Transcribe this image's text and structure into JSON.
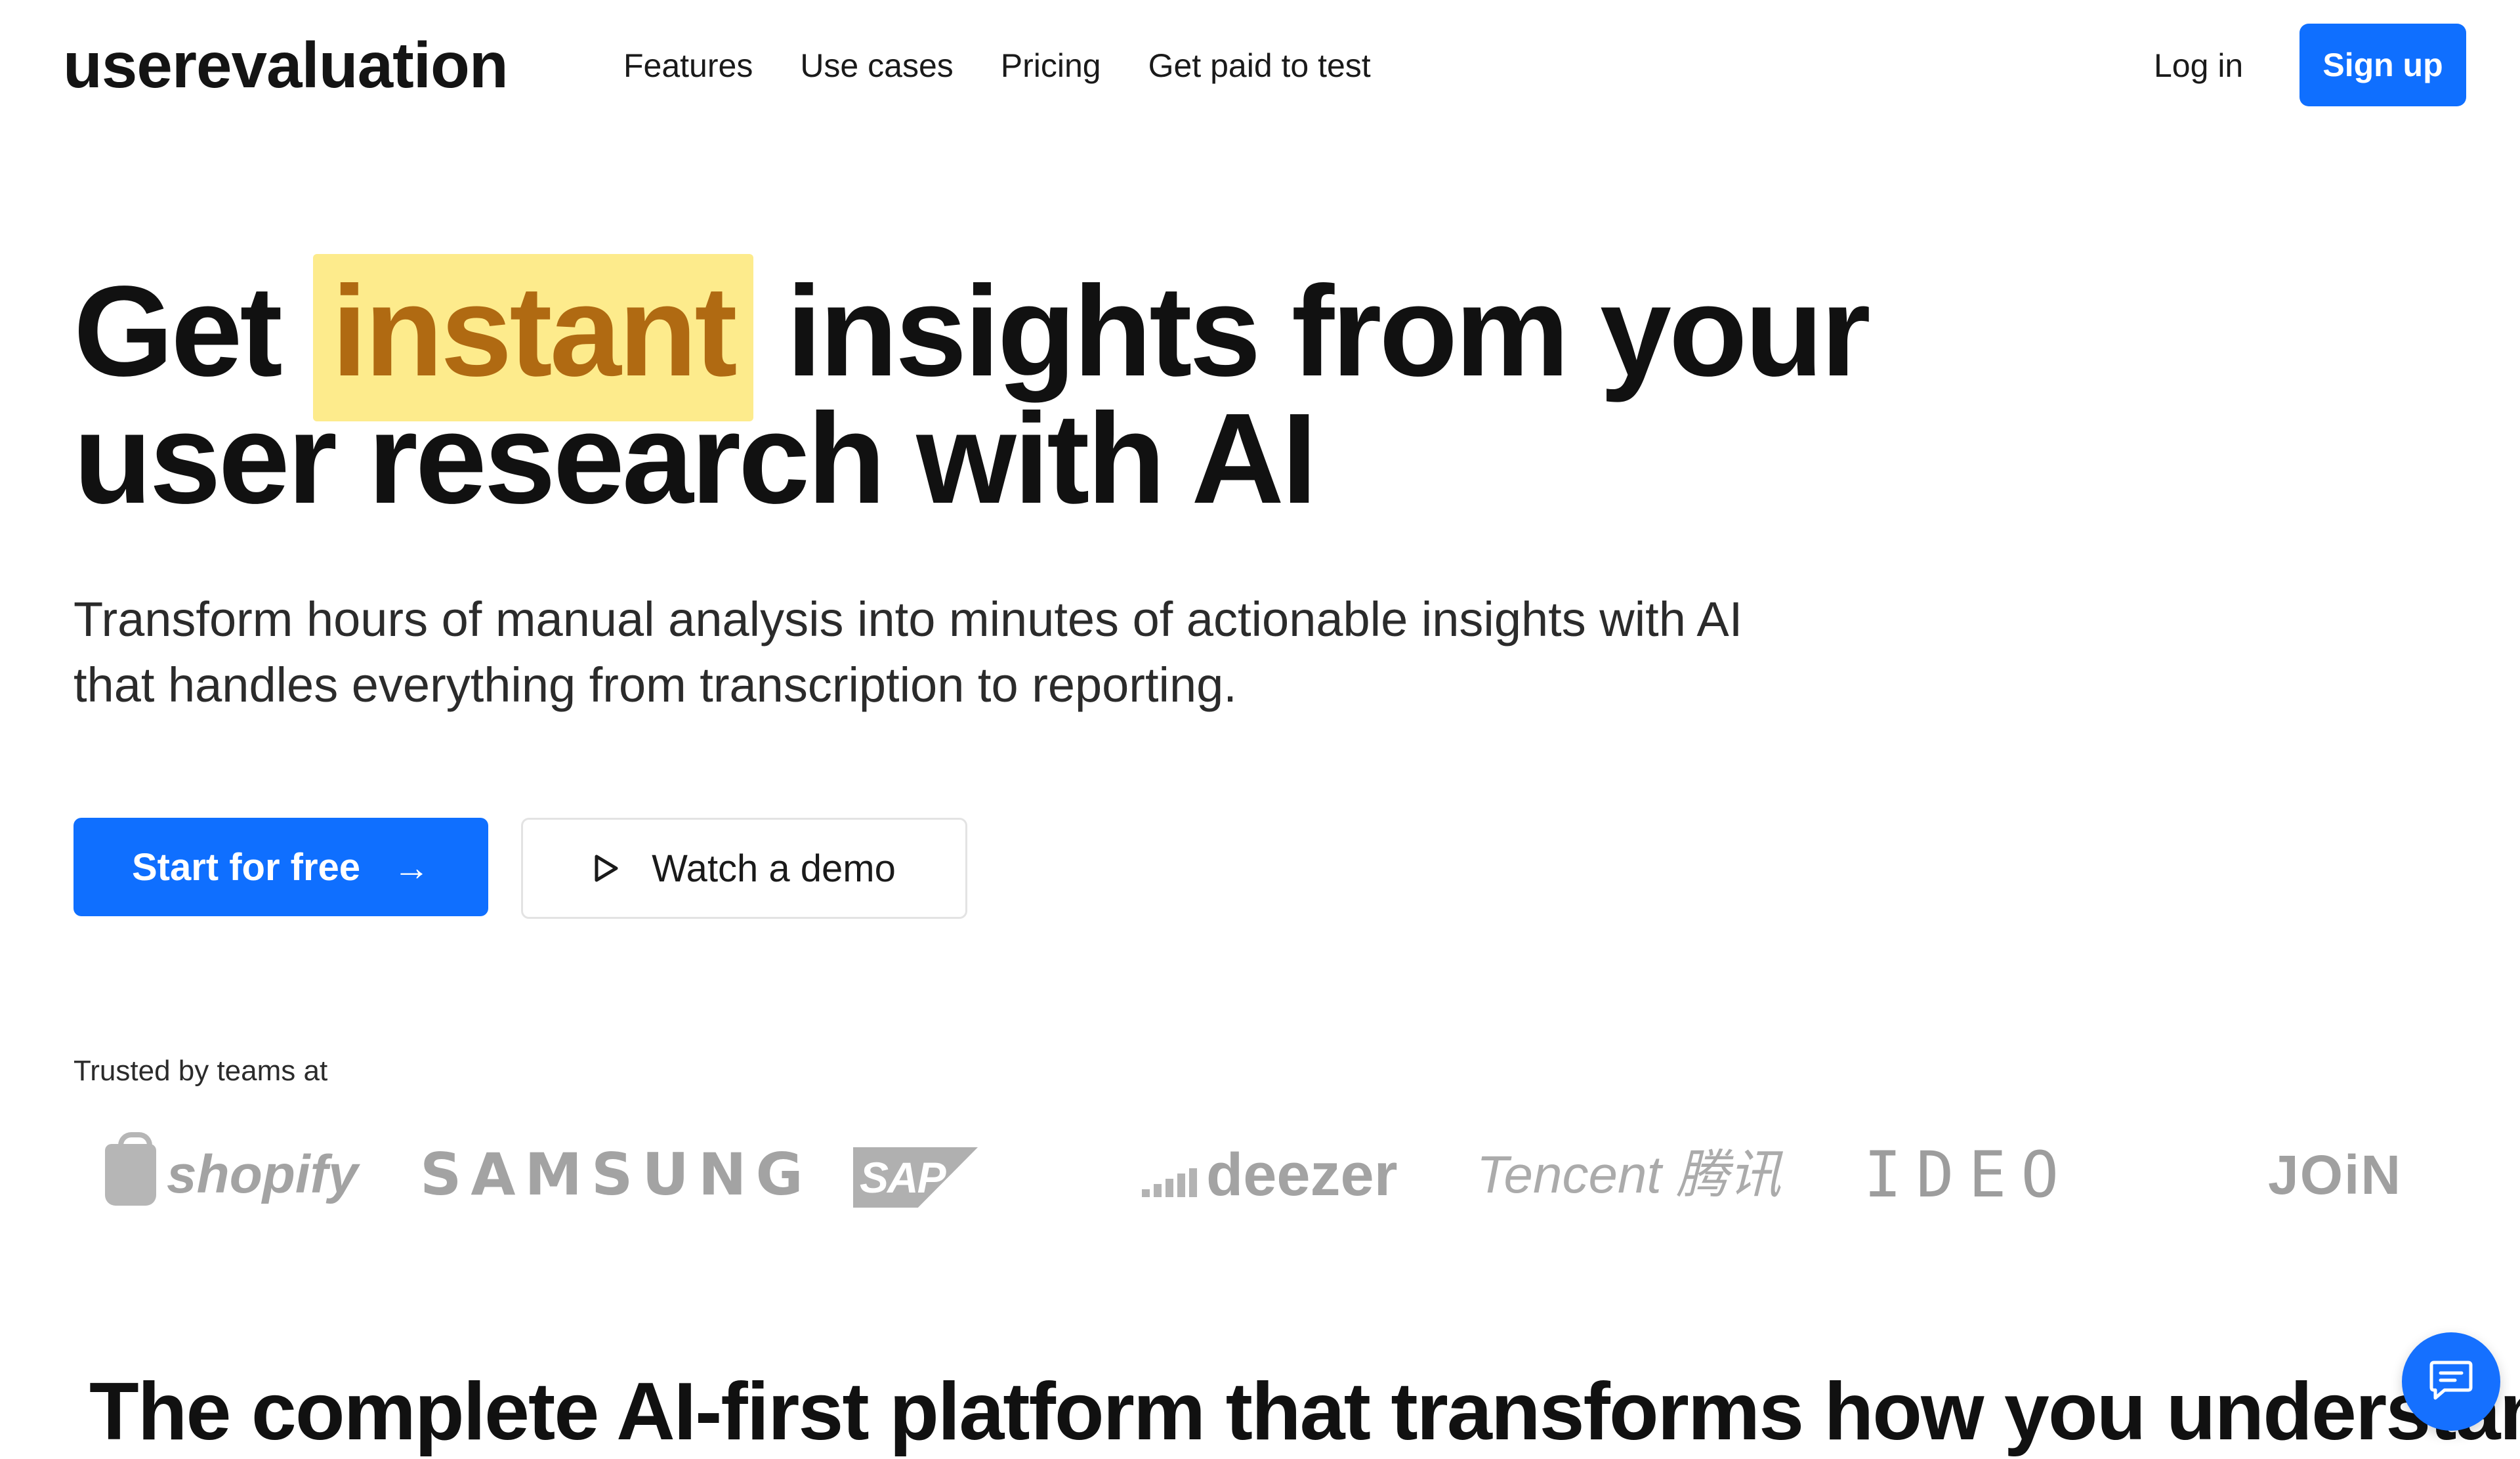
{
  "header": {
    "logo": "userevaluation",
    "nav": [
      "Features",
      "Use cases",
      "Pricing",
      "Get paid to test"
    ],
    "login_label": "Log in",
    "signup_label": "Sign up"
  },
  "hero": {
    "headline_before": "Get ",
    "headline_highlight": "instant",
    "headline_after": " insights from your user research with AI",
    "subheadline": "Transform hours of manual analysis into minutes of actionable insights with AI that handles everything from transcription to reporting.",
    "primary_cta": "Start for free",
    "primary_cta_icon": "→",
    "secondary_cta": "Watch a demo"
  },
  "trusted": {
    "label": "Trusted by teams at",
    "logos": [
      "shopify",
      "SAMSUNG",
      "SAP",
      "deezer",
      "Tencent 腾讯",
      "IDEO",
      "JOiN"
    ]
  },
  "section": {
    "title": "The complete AI-first platform that transforms how you understand"
  },
  "colors": {
    "accent": "#0f6fff",
    "highlight_bg": "#fdeb8c",
    "highlight_text": "#b06a12",
    "logo_gray": "#a3a3a3"
  },
  "icons": {
    "arrow": "arrow-right-icon",
    "play": "play-icon",
    "chat": "chat-bubble-icon"
  }
}
